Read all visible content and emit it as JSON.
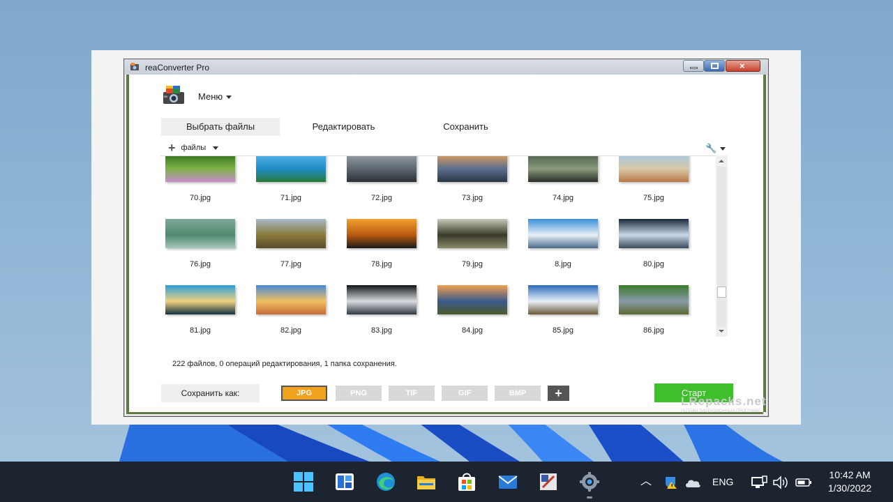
{
  "window": {
    "title": "reaConverter Pro"
  },
  "menu": {
    "label": "Меню"
  },
  "tabs": [
    {
      "label": "Выбрать файлы",
      "active": true
    },
    {
      "label": "Редактировать",
      "active": false
    },
    {
      "label": "Сохранить",
      "active": false
    }
  ],
  "toolbar": {
    "add_files_label": "файлы"
  },
  "files": [
    {
      "name": "70.jpg",
      "colors": [
        "#2b6e1a",
        "#7fb24a",
        "#c98ccf"
      ]
    },
    {
      "name": "71.jpg",
      "colors": [
        "#5ab6e8",
        "#1f8bc6",
        "#2a7a3a"
      ]
    },
    {
      "name": "72.jpg",
      "colors": [
        "#9aa3aa",
        "#5d676f",
        "#2c3036"
      ]
    },
    {
      "name": "73.jpg",
      "colors": [
        "#e8a25a",
        "#5a6e8e",
        "#2b3545"
      ]
    },
    {
      "name": "74.jpg",
      "colors": [
        "#4a5a4a",
        "#8a9a7a",
        "#2a302a"
      ]
    },
    {
      "name": "75.jpg",
      "colors": [
        "#9fc8e8",
        "#d9c8a8",
        "#b87a4a"
      ]
    },
    {
      "name": "76.jpg",
      "colors": [
        "#7fa898",
        "#4e8a6e",
        "#a9c7b9"
      ]
    },
    {
      "name": "77.jpg",
      "colors": [
        "#a7b8c8",
        "#8a7a3a",
        "#5a4a2a"
      ]
    },
    {
      "name": "78.jpg",
      "colors": [
        "#f0a030",
        "#b85a10",
        "#1a1a1a"
      ]
    },
    {
      "name": "79.jpg",
      "colors": [
        "#c8c8b8",
        "#3a3a2a",
        "#8a8a6a"
      ]
    },
    {
      "name": "8.jpg",
      "colors": [
        "#3b8fd8",
        "#e8f0f8",
        "#4a6a8a"
      ]
    },
    {
      "name": "80.jpg",
      "colors": [
        "#1a2a3a",
        "#c8d8e8",
        "#3a4a5a"
      ]
    },
    {
      "name": "81.jpg",
      "colors": [
        "#2aa0d8",
        "#f0d080",
        "#103040"
      ]
    },
    {
      "name": "82.jpg",
      "colors": [
        "#4a8ad8",
        "#f0c060",
        "#c86a3a"
      ]
    },
    {
      "name": "83.jpg",
      "colors": [
        "#101418",
        "#d8dce0",
        "#303840"
      ]
    },
    {
      "name": "84.jpg",
      "colors": [
        "#f0a050",
        "#3a5a8a",
        "#4a5a2a"
      ]
    },
    {
      "name": "85.jpg",
      "colors": [
        "#2a6ab8",
        "#e8f0f8",
        "#6a5a3a"
      ]
    },
    {
      "name": "86.jpg",
      "colors": [
        "#3a7a2a",
        "#8a9aa8",
        "#5a6a30"
      ]
    }
  ],
  "status": {
    "text": "222 файлов, 0 операций редактирования, 1 папка сохранения."
  },
  "save_as": {
    "label": "Сохранить как:"
  },
  "formats": [
    {
      "label": "JPG",
      "active": true
    },
    {
      "label": "PNG",
      "active": false
    },
    {
      "label": "TIF",
      "active": false
    },
    {
      "label": "GIF",
      "active": false
    },
    {
      "label": "BMP",
      "active": false
    }
  ],
  "start_button": {
    "label": "Старт"
  },
  "watermark": {
    "line1": "LRepacks.net",
    "line2": "РЕПАКИ ЛИЦЕНЗИОННЫХ ПРОГРАММ"
  },
  "taskbar": {
    "apps": [
      "windows-start-icon",
      "widgets-icon",
      "edge-icon",
      "file-explorer-icon",
      "store-icon",
      "mail-icon",
      "app-icon",
      "settings-gear-icon"
    ],
    "language": "ENG",
    "time": "10:42 AM",
    "date": "1/30/2022"
  },
  "colors": {
    "accent_start": "#3fbf2b",
    "format_active": "#f0a11e",
    "taskbar": "#1c2430"
  }
}
